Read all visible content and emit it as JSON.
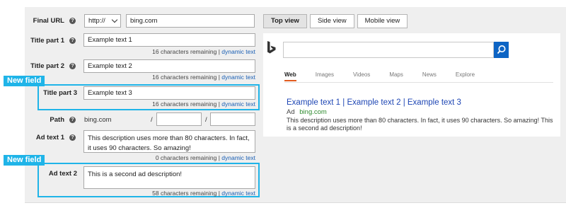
{
  "form": {
    "final_url": {
      "label": "Final URL",
      "help": "?",
      "protocol": "http://",
      "value": "bing.com"
    },
    "title1": {
      "label": "Title part 1",
      "help": "?",
      "value": "Example text 1",
      "remaining": "16 characters remaining",
      "sep": "|",
      "link": "dynamic text"
    },
    "title2": {
      "label": "Title part 2",
      "help": "?",
      "value": "Example text 2",
      "remaining": "16 characters remaining",
      "sep": "|",
      "link": "dynamic text"
    },
    "title3": {
      "label": "Title part 3",
      "value": "Example text 3",
      "remaining": "16 characters remaining",
      "sep": "|",
      "link": "dynamic text"
    },
    "path": {
      "label": "Path",
      "help": "?",
      "domain": "bing.com",
      "slash1": "/",
      "slash2": "/",
      "path1": "",
      "path2": ""
    },
    "ad_text1": {
      "label": "Ad text 1",
      "help": "?",
      "value": "This description uses more than 80 characters. In fact, it uses 90 characters. So amazing!",
      "remaining": "0 characters remaining",
      "sep": "|",
      "link": "dynamic text"
    },
    "ad_text2": {
      "label": "Ad text 2",
      "value": "This is a second ad description!",
      "remaining": "58 characters remaining",
      "sep": "|",
      "link": "dynamic text"
    }
  },
  "new_field_tag": "New field",
  "highlight_color": "#1fb4e8",
  "preview_tabs": [
    {
      "label": "Top view",
      "active": true
    },
    {
      "label": "Side view",
      "active": false
    },
    {
      "label": "Mobile view",
      "active": false
    }
  ],
  "preview": {
    "logo_icon": "bing-logo-icon",
    "search_icon": "magnifier-icon",
    "nav": [
      "Web",
      "Images",
      "Videos",
      "Maps",
      "News",
      "Explore"
    ],
    "nav_active": "Web",
    "ad": {
      "title": "Example text 1 | Example text 2 | Example text 3",
      "badge": "Ad",
      "domain": "bing.com",
      "description": "This description uses more than 80 characters. In fact, it uses 90 characters. So amazing! This is a second ad description!"
    }
  }
}
